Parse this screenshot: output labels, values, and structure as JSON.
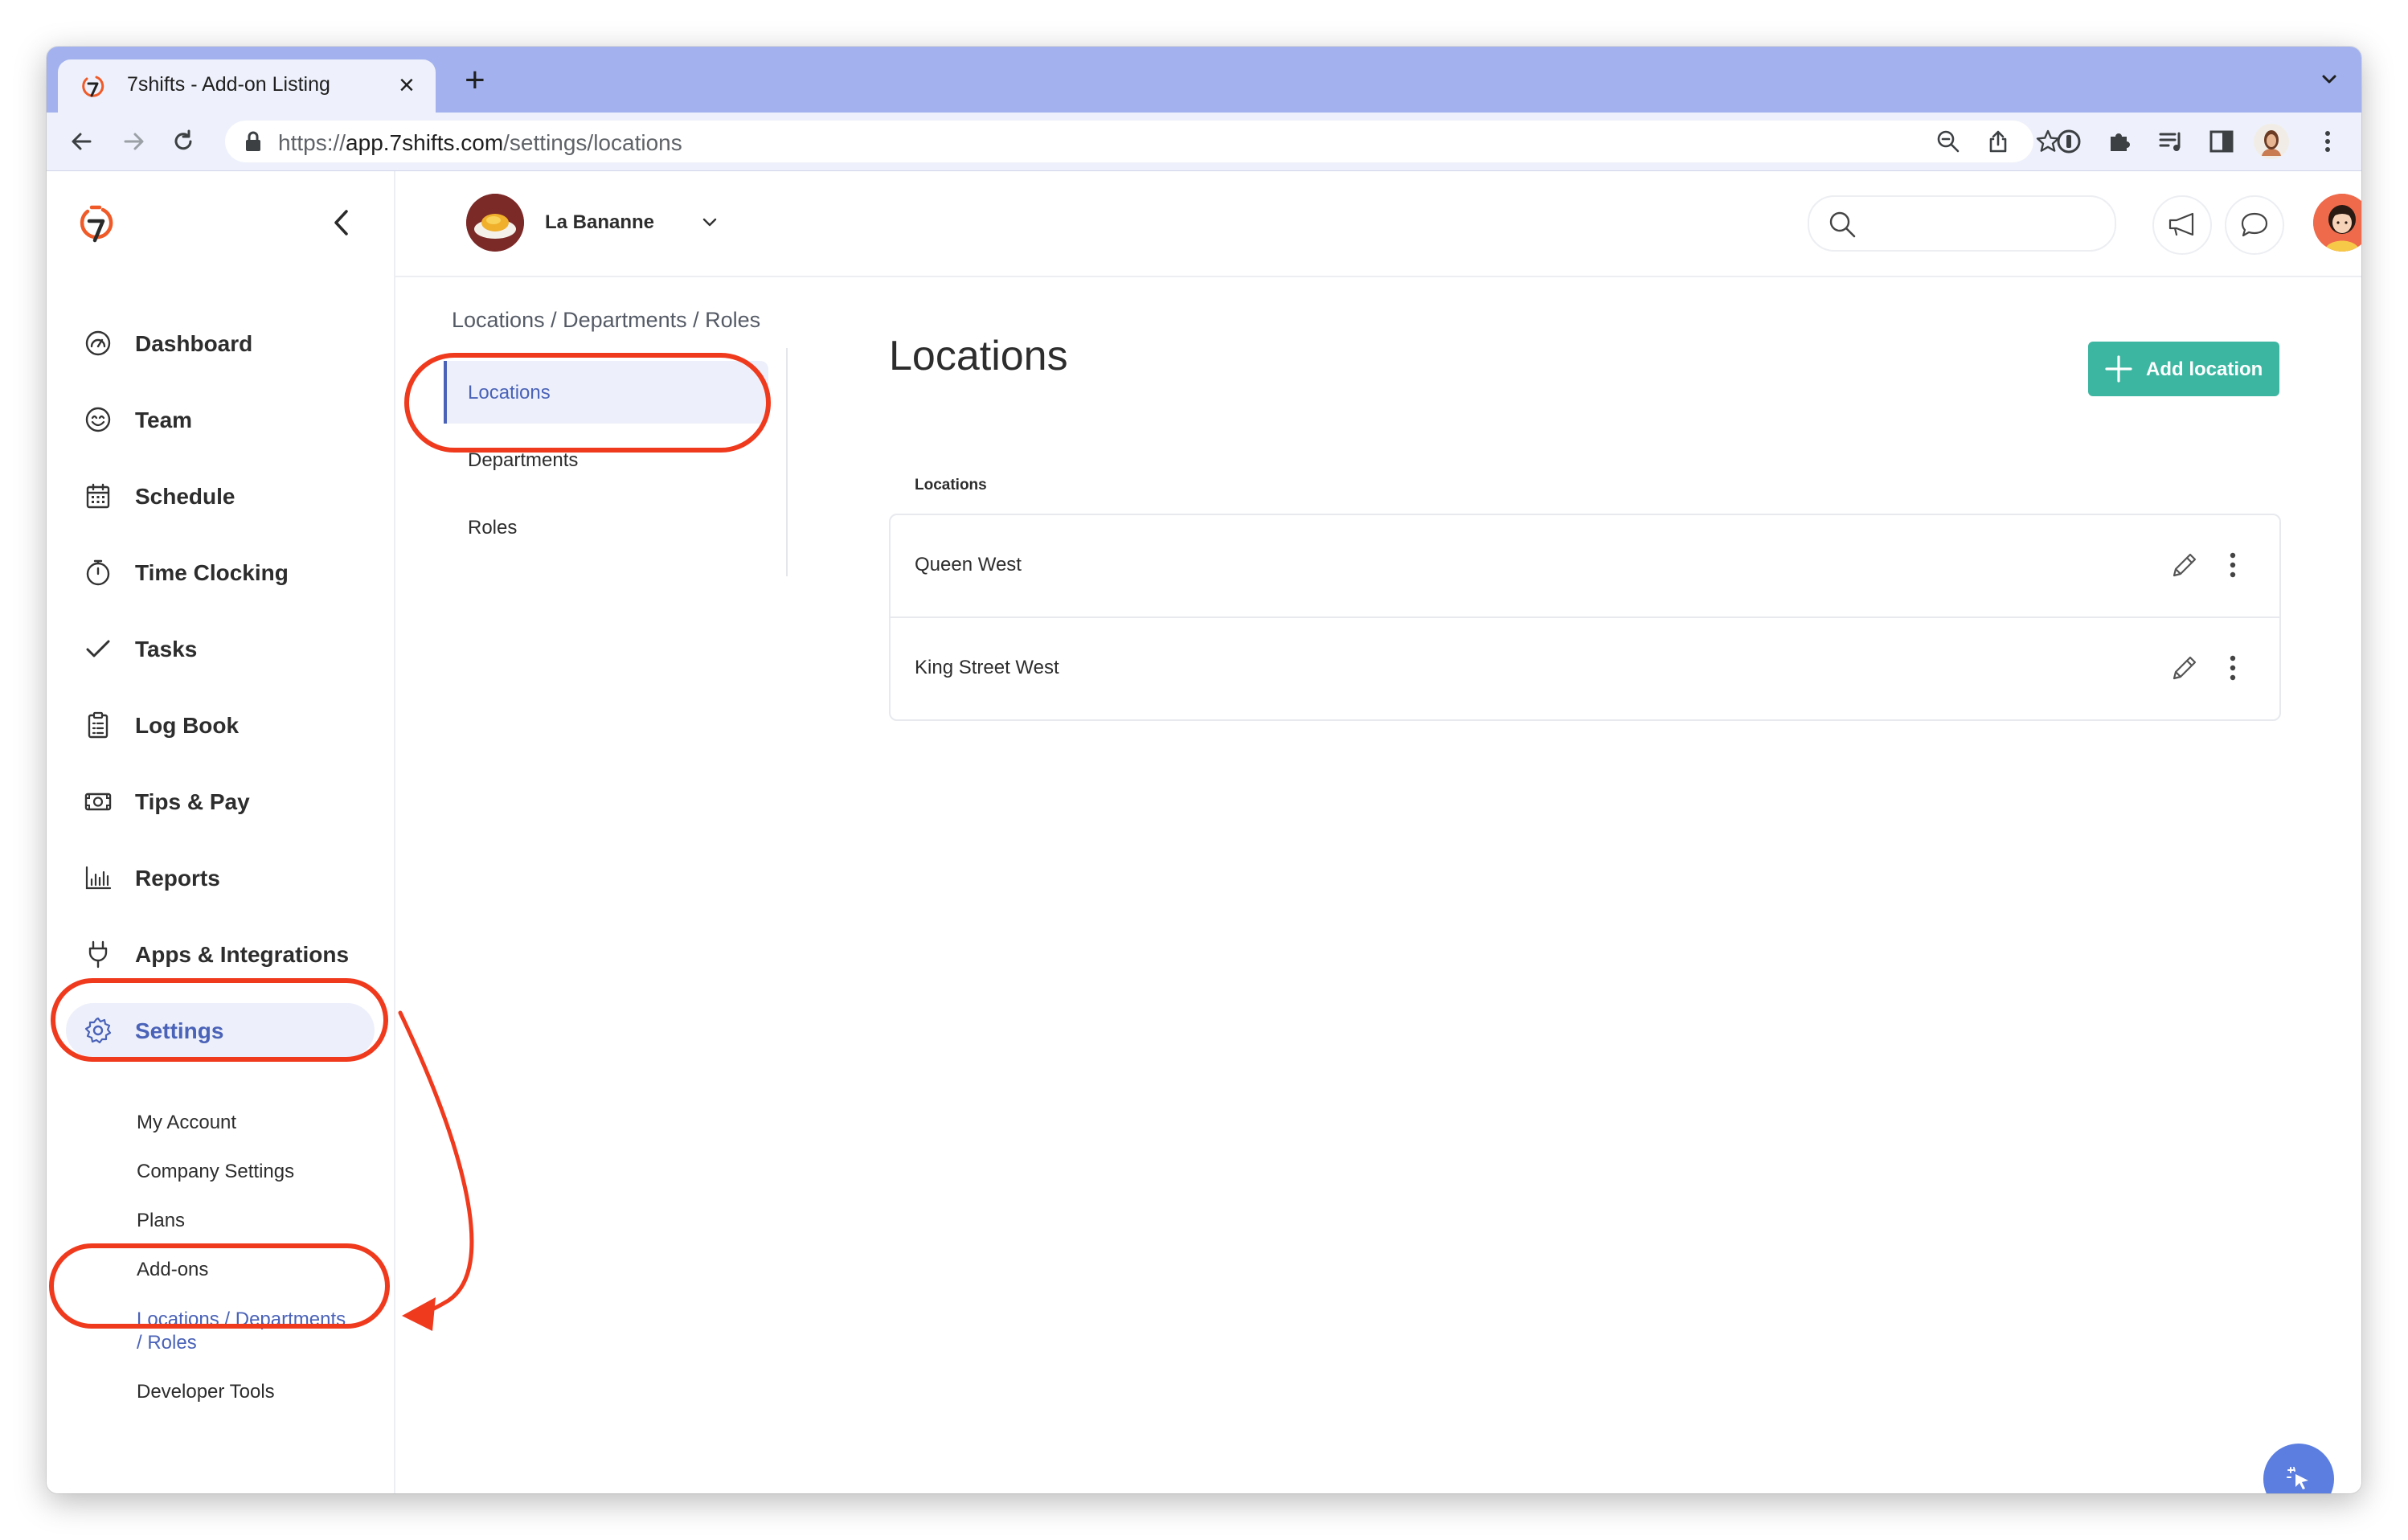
{
  "browser": {
    "tab_title": "7shifts - Add-on Listing",
    "url_scheme": "https://",
    "url_host": "app.7shifts.com",
    "url_path": "/settings/locations"
  },
  "header": {
    "location_name": "La Bananne"
  },
  "sidebar": {
    "nav": [
      {
        "label": "Dashboard",
        "icon": "dashboard-gauge-icon"
      },
      {
        "label": "Team",
        "icon": "smiley-icon"
      },
      {
        "label": "Schedule",
        "icon": "calendar-icon"
      },
      {
        "label": "Time Clocking",
        "icon": "stopwatch-icon"
      },
      {
        "label": "Tasks",
        "icon": "checkmark-icon"
      },
      {
        "label": "Log Book",
        "icon": "clipboard-icon"
      },
      {
        "label": "Tips & Pay",
        "icon": "money-icon"
      },
      {
        "label": "Reports",
        "icon": "bar-chart-icon"
      },
      {
        "label": "Apps & Integrations",
        "icon": "plug-icon"
      },
      {
        "label": "Settings",
        "icon": "gear-icon"
      }
    ],
    "settings_sub": [
      {
        "label": "My Account"
      },
      {
        "label": "Company Settings"
      },
      {
        "label": "Plans"
      },
      {
        "label": "Add-ons"
      },
      {
        "label_line1": "Locations / Departments",
        "label_line2": "/ Roles"
      },
      {
        "label": "Developer Tools"
      }
    ]
  },
  "subnav": {
    "breadcrumb": "Locations / Departments / Roles",
    "items": [
      {
        "label": "Locations"
      },
      {
        "label": "Departments"
      },
      {
        "label": "Roles"
      }
    ]
  },
  "main": {
    "title": "Locations",
    "add_button_label": "Add location",
    "column_header": "Locations",
    "rows": [
      {
        "name": "Queen West"
      },
      {
        "name": "King Street West"
      }
    ]
  },
  "colors": {
    "accent": "#4a62b8",
    "add_button": "#3cb6a1",
    "annotation": "#f03a1e",
    "tabstrip": "#a3b2ee"
  }
}
